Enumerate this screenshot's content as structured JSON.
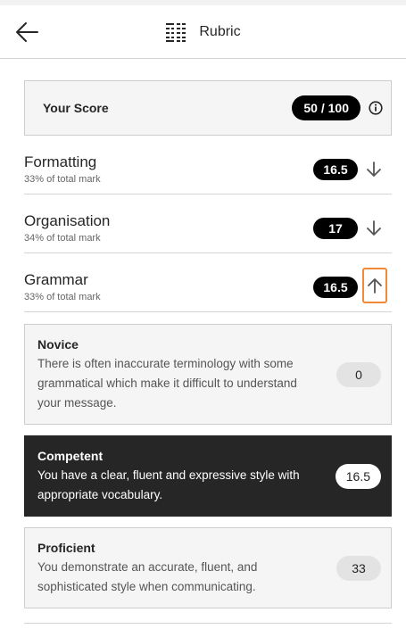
{
  "header": {
    "title": "Rubric",
    "back_icon": "arrow-left-icon",
    "title_icon": "rubric-grid-icon"
  },
  "score": {
    "label": "Your Score",
    "value": "50 / 100",
    "info_icon": "info-icon"
  },
  "criteria": [
    {
      "name": "Formatting",
      "subtitle": "33% of total mark",
      "score": "16.5",
      "toggle_icon": "arrow-down-icon",
      "expanded": false
    },
    {
      "name": "Organisation",
      "subtitle": "34% of total mark",
      "score": "17",
      "toggle_icon": "arrow-down-icon",
      "expanded": false
    },
    {
      "name": "Grammar",
      "subtitle": "33% of total mark",
      "score": "16.5",
      "toggle_icon": "arrow-up-icon",
      "expanded": true
    }
  ],
  "levels": [
    {
      "title": "Novice",
      "description": "There is often inaccurate terminology with some grammatical which make it difficult to understand your message.",
      "points": "0",
      "selected": false
    },
    {
      "title": "Competent",
      "description": "You have a clear, fluent and expressive style with appropriate vocabulary.",
      "points": "16.5",
      "selected": true
    },
    {
      "title": "Proficient",
      "description": "You demonstrate an accurate, fluent, and sophisticated style when communicating.",
      "points": "33",
      "selected": false
    }
  ],
  "colors": {
    "focus_outline": "#f08a38",
    "selected_level_bg": "#262626",
    "pill_bg": "#000000"
  }
}
